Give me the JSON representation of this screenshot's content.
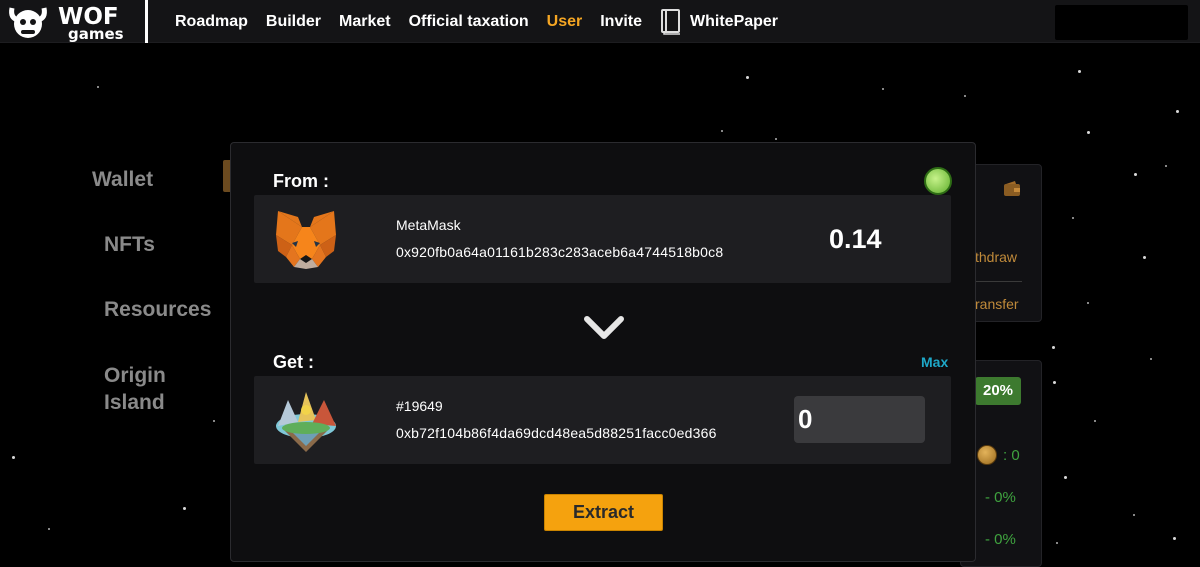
{
  "brand": {
    "logo_text_top": "WOF",
    "logo_text_bottom": "games"
  },
  "nav": {
    "items": [
      {
        "label": "Roadmap"
      },
      {
        "label": "Builder"
      },
      {
        "label": "Market"
      },
      {
        "label": "Official taxation"
      },
      {
        "label": "User",
        "active": true
      },
      {
        "label": "Invite"
      }
    ],
    "whitepaper": {
      "label": "WhitePaper",
      "icon": "book-icon"
    }
  },
  "sidebar": {
    "items": [
      {
        "label": "Wallet"
      },
      {
        "label": "NFTs"
      },
      {
        "label": "Resources"
      },
      {
        "label": "Origin Island"
      }
    ]
  },
  "background_panel": {
    "withdraw_partial": "thdraw",
    "transfer_partial": "ransfer",
    "tax_badge": "20%",
    "coin_value": ": 0",
    "percent_1": "- 0%",
    "percent_2": "- 0%"
  },
  "modal": {
    "from_label": "From :",
    "get_label": "Get :",
    "max_label": "Max",
    "from": {
      "name": "MetaMask",
      "address": "0x920fb0a64a01161b283c283aceb6a4744518b0c8",
      "amount": "0.14",
      "icon": "metamask-fox-icon"
    },
    "get": {
      "name": "#19649",
      "address": "0xb72f104b86f4da69dcd48ea5d88251facc0ed366",
      "input_value": "0",
      "icon": "island-icon"
    },
    "extract_label": "Extract"
  },
  "colors": {
    "accent": "#f5a623",
    "button": "#f5a20e",
    "max_link": "#1ea8c8",
    "green": "#3fa33f"
  }
}
